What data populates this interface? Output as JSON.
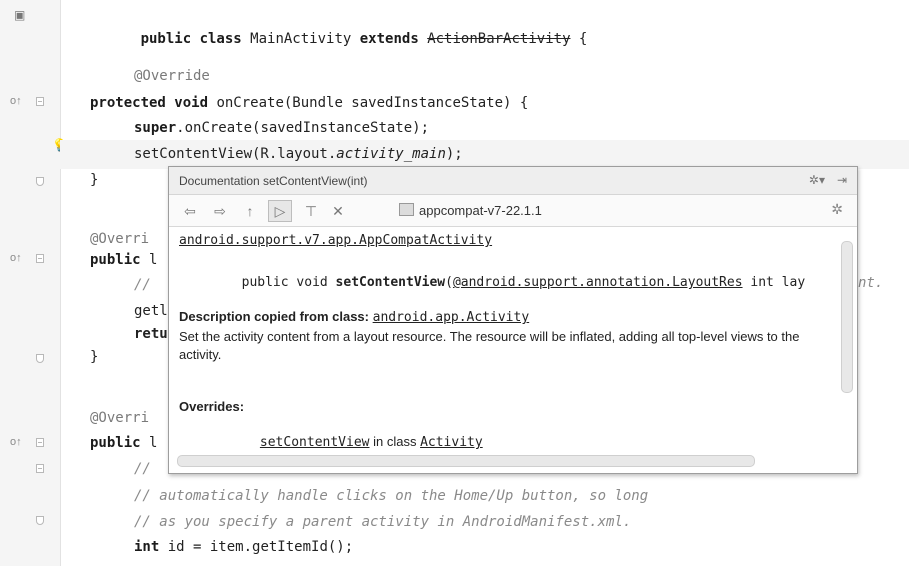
{
  "editor": {
    "line1": {
      "kw1": "public class",
      "name": " MainActivity ",
      "kw2": "extends",
      "super": "ActionBarActivity",
      "brace": " {"
    },
    "ann1": "@Override",
    "oncreate_sig": {
      "kw": "protected void",
      "rest": " onCreate(Bundle savedInstanceState) {"
    },
    "super_call": {
      "kw": "super",
      "rest": ".onCreate(savedInstanceState);"
    },
    "setcontent": {
      "pre": "setContentView(R.layout.",
      "ital": "activity_main",
      "post": ");"
    },
    "close1": "}",
    "ann2": "@Overri",
    "pub2": {
      "kw": "public",
      "rest": " l"
    },
    "l7": "// ",
    "l8": "getl",
    "l9": "retu",
    "close2": "}",
    "ann3": "@Overri",
    "pub3": {
      "kw": "public",
      "rest": " l"
    },
    "l13": "//",
    "l14": "// automatically handle clicks on the Home/Up button, so long",
    "l15": "// as you specify a parent activity in AndroidManifest.xml.",
    "l16": {
      "kw": "int",
      "rest": " id = item.getItemId();"
    },
    "ext_comment": "nt."
  },
  "popup": {
    "title": "Documentation setContentView(int)",
    "library": "appcompat-v7-22.1.1",
    "class_link": "android.support.v7.app.AppCompatActivity",
    "sig": {
      "pre": "public void ",
      "method": "setContentView",
      "paren": "(",
      "ann": "@android.support.annotation.LayoutRes",
      "post": " int lay"
    },
    "desc_label": "Description copied from class:",
    "desc_class": "android.app.Activity",
    "desc_text": "Set the activity content from a layout resource. The resource will be inflated, adding all top-level views to the activity.",
    "overrides_label": "Overrides:",
    "overrides_method": "setContentView",
    "overrides_in": " in class ",
    "overrides_class": "Activity"
  }
}
